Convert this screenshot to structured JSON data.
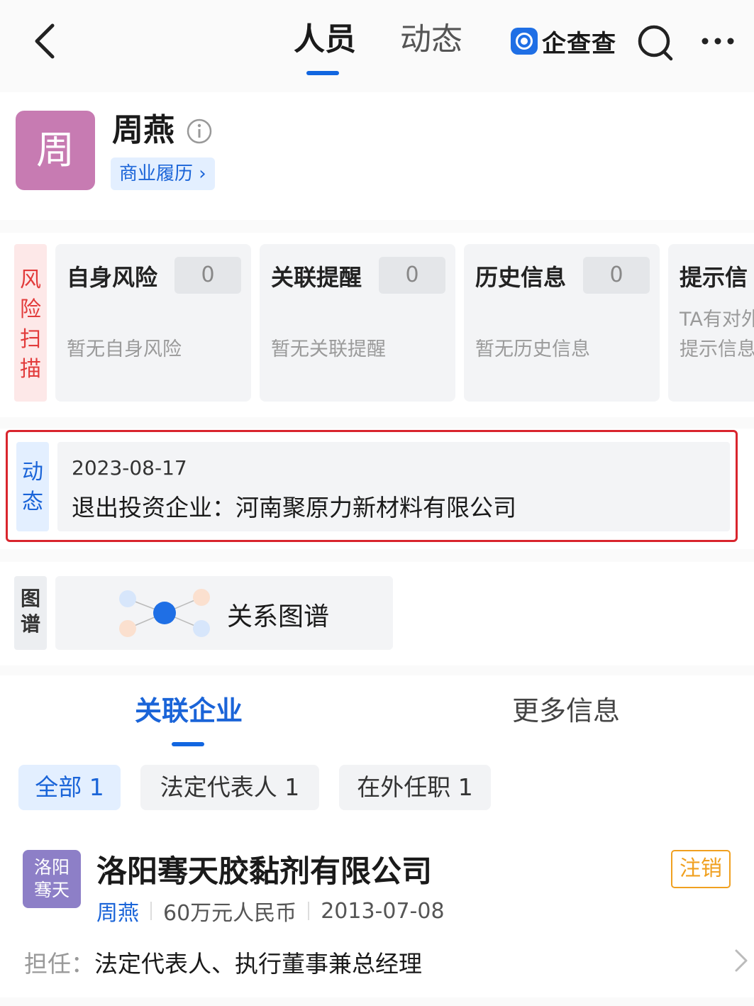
{
  "nav": {
    "tabs": [
      {
        "label": "人员"
      },
      {
        "label": "动态"
      }
    ],
    "brand": "企查查",
    "icons": {
      "back": "back-arrow-icon",
      "search": "search-icon",
      "more": "more-icon"
    }
  },
  "profile": {
    "avatar_char": "周",
    "name": "周燕",
    "career_link": "商业履历 ›"
  },
  "risk_scan": {
    "tag": "风险扫描",
    "cards": [
      {
        "title": "自身风险",
        "count": "0",
        "desc": "暂无自身风险"
      },
      {
        "title": "关联提醒",
        "count": "0",
        "desc": "暂无关联提醒"
      },
      {
        "title": "历史信息",
        "count": "0",
        "desc": "暂无历史信息"
      },
      {
        "title": "提示信",
        "line1": "TA有对外",
        "line2": "提示信息"
      }
    ]
  },
  "dynamic": {
    "tag": "动态",
    "date": "2023-08-17",
    "text": "退出投资企业：河南聚原力新材料有限公司"
  },
  "graph": {
    "tag": "图谱",
    "label": "关系图谱"
  },
  "section_tabs": [
    {
      "label": "关联企业"
    },
    {
      "label": "更多信息"
    }
  ],
  "filters": [
    {
      "label": "全部 1"
    },
    {
      "label": "法定代表人 1"
    },
    {
      "label": "在外任职 1"
    }
  ],
  "company": {
    "logo_line1": "洛阳",
    "logo_line2": "骞天",
    "name": "洛阳骞天胶黏剂有限公司",
    "status": "注销",
    "person": "周燕",
    "capital": "60万元人民币",
    "date": "2013-07-08",
    "role_label": "担任：",
    "role": "法定代表人、执行董事兼总经理"
  },
  "colors": {
    "accent": "#1a64d8",
    "avatar": "#c77bb2",
    "risk_red": "#e23b3b",
    "highlight_border": "#d9252d",
    "status_orange": "#f0a020",
    "company_logo": "#8d7fc7"
  }
}
